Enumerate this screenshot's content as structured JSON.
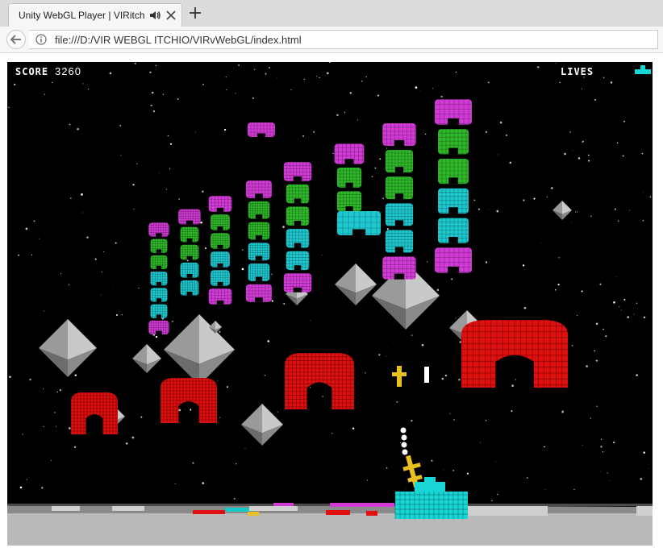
{
  "browser": {
    "tab_title": "Unity WebGL Player | VIRitch",
    "url": "file:///D:/VIR WEBGL ITCHIO/VIRvWebGL/index.html",
    "icons": {
      "audio": "speaker-icon",
      "close": "close-icon",
      "new_tab": "plus-icon",
      "back": "back-arrow-icon",
      "info": "info-icon"
    }
  },
  "hud": {
    "score_label": "SCORE",
    "score_value": "3260",
    "lives_label": "LIVES",
    "lives_remaining": 1
  },
  "colors": {
    "invader_magenta": "#d23ad6",
    "invader_green": "#2fb82a",
    "invader_cyan": "#1ec8cf",
    "shield_red": "#e01010",
    "player_cyan": "#18d6d6",
    "rock_gray": "#9a9a9a",
    "bullet_gold": "#e8c020"
  }
}
